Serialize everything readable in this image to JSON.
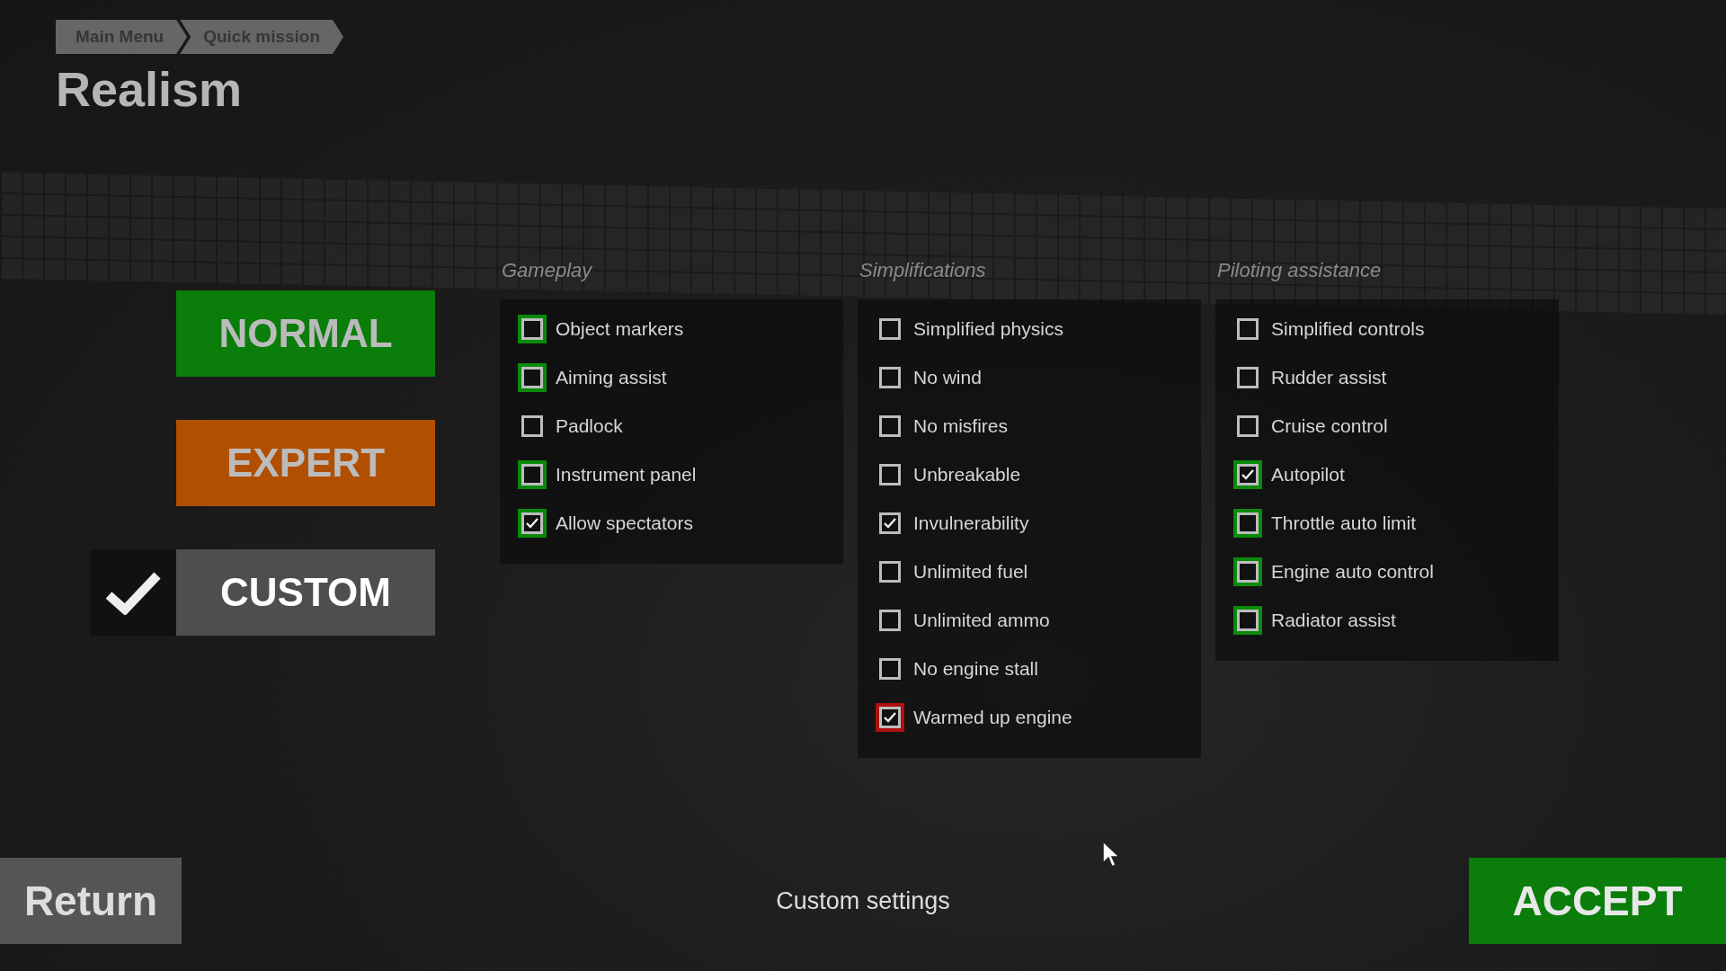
{
  "breadcrumb": [
    "Main Menu",
    "Quick mission"
  ],
  "title": "Realism",
  "presets": [
    {
      "label": "NORMAL",
      "kind": "normal",
      "selected": false
    },
    {
      "label": "EXPERT",
      "kind": "expert",
      "selected": false
    },
    {
      "label": "CUSTOM",
      "kind": "custom",
      "selected": true
    }
  ],
  "columns": [
    {
      "title": "Gameplay",
      "options": [
        {
          "label": "Object markers",
          "checked": false,
          "color": "#0a8a0a"
        },
        {
          "label": "Aiming assist",
          "checked": false,
          "color": "#0a8a0a"
        },
        {
          "label": "Padlock",
          "checked": false
        },
        {
          "label": "Instrument panel",
          "checked": false,
          "color": "#0a8a0a"
        },
        {
          "label": "Allow spectators",
          "checked": true,
          "color": "#0a8a0a"
        }
      ]
    },
    {
      "title": "Simplifications",
      "options": [
        {
          "label": "Simplified physics",
          "checked": false
        },
        {
          "label": "No wind",
          "checked": false
        },
        {
          "label": "No misfires",
          "checked": false
        },
        {
          "label": "Unbreakable",
          "checked": false
        },
        {
          "label": "Invulnerability",
          "checked": true
        },
        {
          "label": "Unlimited fuel",
          "checked": false
        },
        {
          "label": "Unlimited ammo",
          "checked": false
        },
        {
          "label": "No engine stall",
          "checked": false
        },
        {
          "label": "Warmed up engine",
          "checked": true,
          "color": "#b01010"
        }
      ]
    },
    {
      "title": "Piloting assistance",
      "options": [
        {
          "label": "Simplified controls",
          "checked": false
        },
        {
          "label": "Rudder assist",
          "checked": false
        },
        {
          "label": "Cruise control",
          "checked": false
        },
        {
          "label": "Autopilot",
          "checked": true,
          "color": "#0a8a0a"
        },
        {
          "label": "Throttle auto limit",
          "checked": false,
          "color": "#0a8a0a"
        },
        {
          "label": "Engine auto control",
          "checked": false,
          "color": "#0a8a0a"
        },
        {
          "label": "Radiator assist",
          "checked": false,
          "color": "#0a8a0a"
        }
      ]
    }
  ],
  "footer": {
    "return_button": "Return",
    "status": "Custom settings",
    "accept_button": "ACCEPT"
  }
}
